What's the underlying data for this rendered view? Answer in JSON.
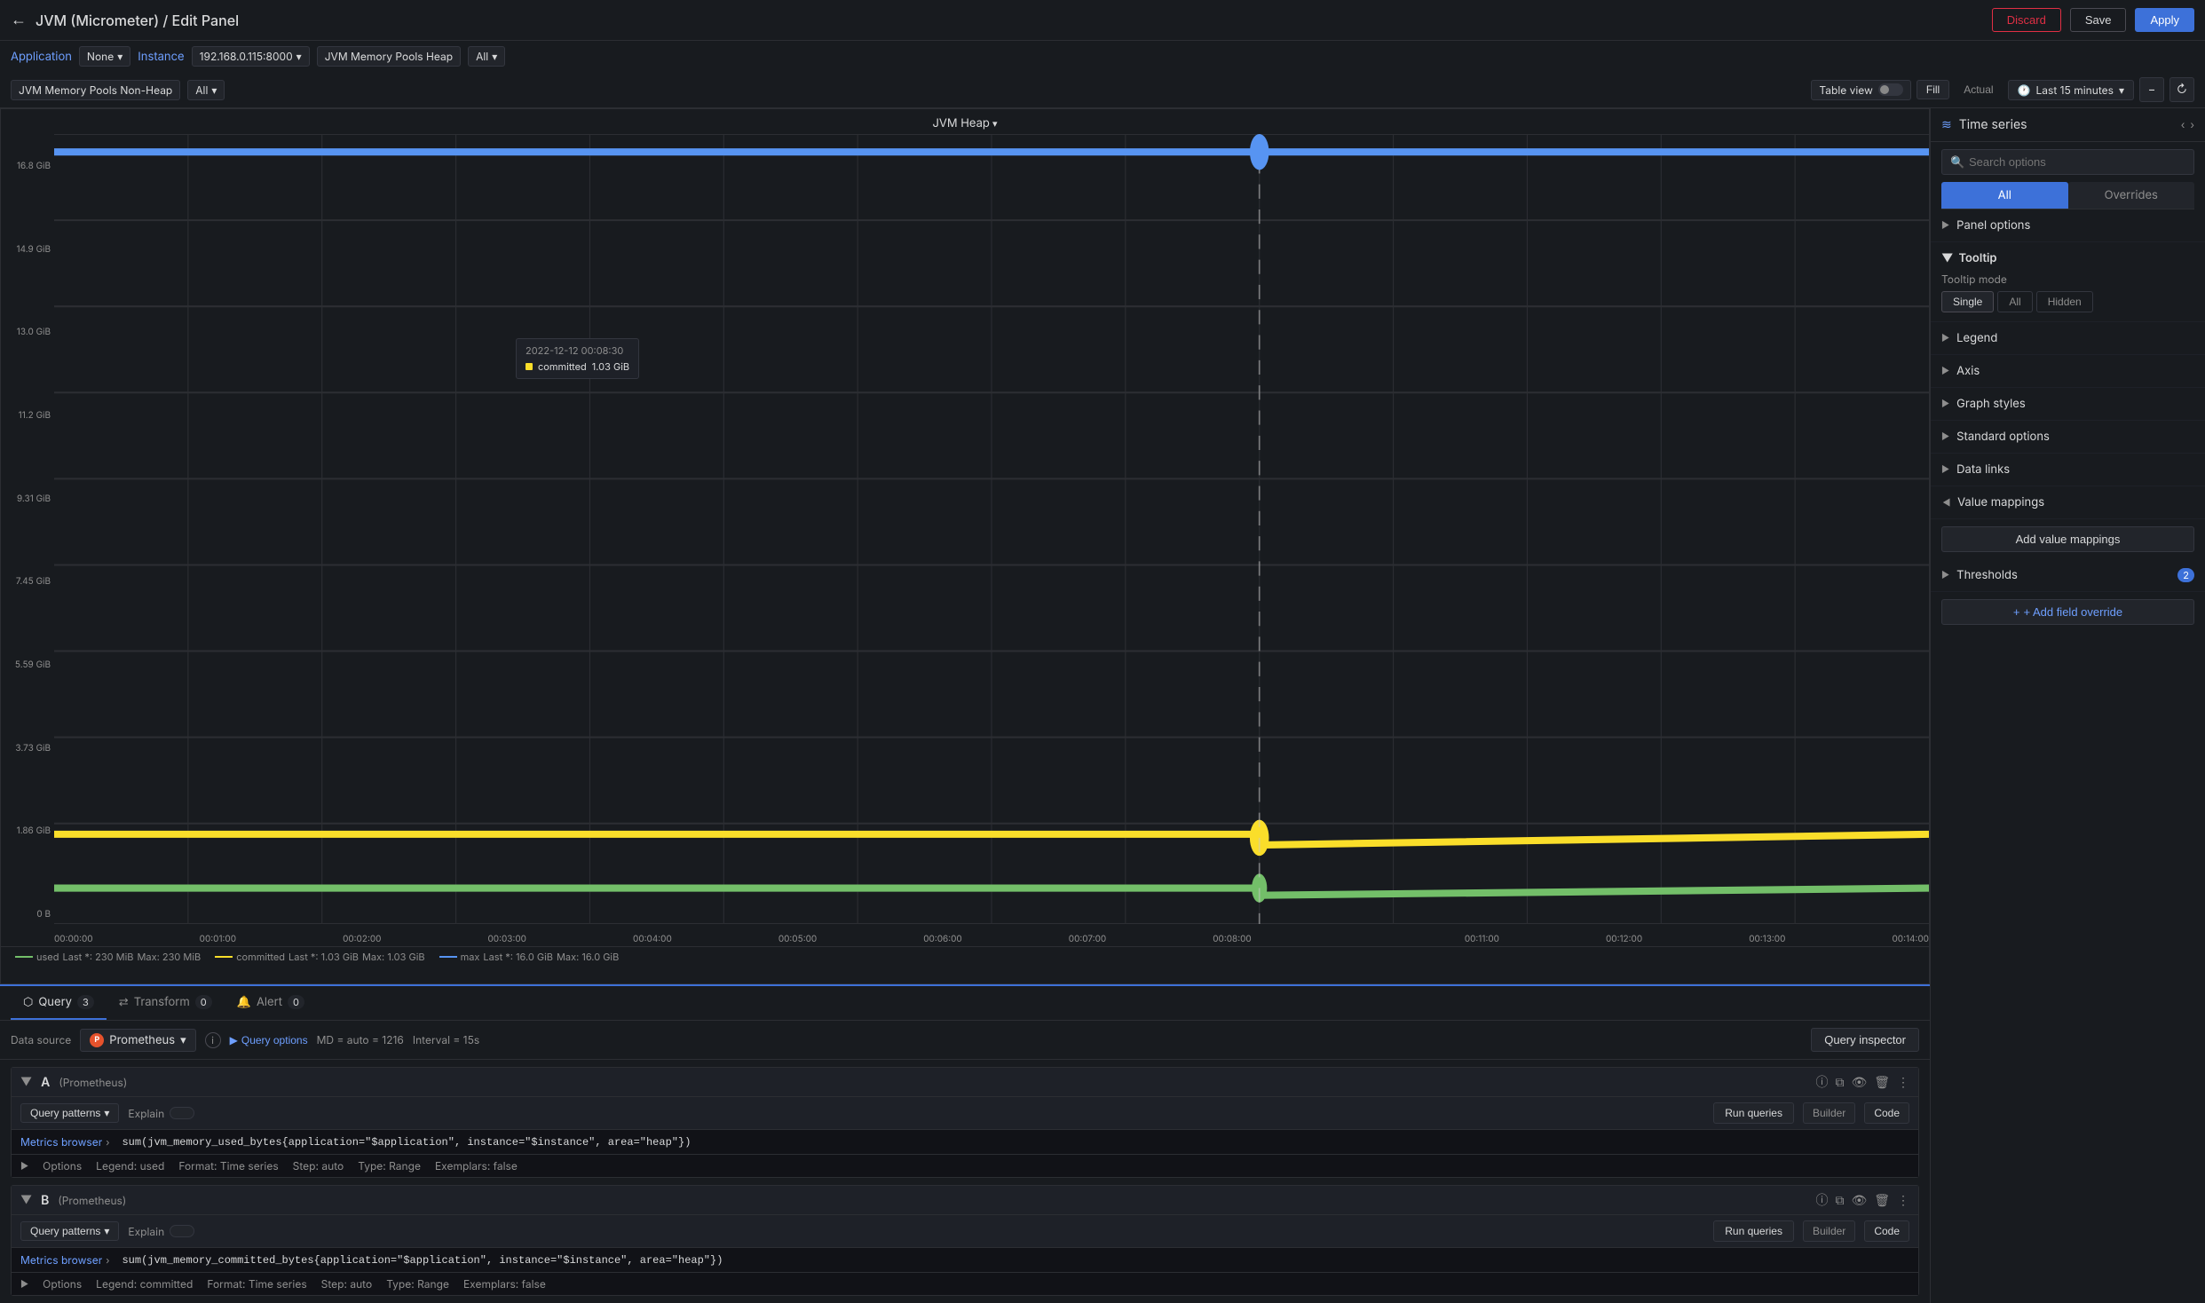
{
  "topbar": {
    "back_label": "←",
    "title": "JVM (Micrometer) / Edit Panel",
    "discard_label": "Discard",
    "save_label": "Save",
    "apply_label": "Apply"
  },
  "filterbar": {
    "application_label": "Application",
    "application_value": "None",
    "instance_label": "Instance",
    "instance_value": "192.168.0.115:8000",
    "heap_label": "JVM Memory Pools Heap",
    "heap_value": "All",
    "non_heap_label": "JVM Memory Pools Non-Heap",
    "non_heap_value": "All",
    "table_view_label": "Table view",
    "fill_label": "Fill",
    "actual_label": "Actual",
    "time_label": "Last 15 minutes"
  },
  "chart": {
    "title": "JVM Heap",
    "y_labels": [
      "16.8 GiB",
      "14.9 GiB",
      "13.0 GiB",
      "11.2 GiB",
      "9.31 GiB",
      "7.45 GiB",
      "5.59 GiB",
      "3.73 GiB",
      "1.86 GiB",
      "0 B"
    ],
    "x_labels": [
      "00:00:00",
      "00:01:00",
      "00:02:00",
      "00:03:00",
      "00:04:00",
      "00:05:00",
      "00:06:00",
      "00:07:00",
      "00:08:00",
      "",
      "00:11:00",
      "00:12:00",
      "00:13:00",
      "00:14:00"
    ],
    "tooltip": {
      "time": "2022-12-12 00:08:30",
      "label": "committed",
      "value": "1.03 GiB"
    },
    "legend": [
      {
        "label": "used",
        "color": "#73bf69",
        "last": "Last *: 230 MiB",
        "max": "Max: 230 MiB"
      },
      {
        "label": "committed",
        "color": "#fade2a",
        "last": "Last *: 1.03 GiB",
        "max": "Max: 1.03 GiB"
      },
      {
        "label": "max",
        "color": "#5794f2",
        "last": "Last *: 16.0 GiB",
        "max": "Max: 16.0 GiB"
      }
    ]
  },
  "query_tabs": {
    "query_label": "Query",
    "query_count": "3",
    "transform_label": "Transform",
    "transform_count": "0",
    "alert_label": "Alert",
    "alert_count": "0"
  },
  "datasource_bar": {
    "label": "Data source",
    "name": "Prometheus",
    "query_options_label": "Query options",
    "md_label": "MD = auto = 1216",
    "interval_label": "Interval = 15s",
    "inspector_label": "Query inspector"
  },
  "queries": [
    {
      "id": "A",
      "source": "(Prometheus)",
      "patterns_label": "Query patterns",
      "explain_label": "Explain",
      "run_label": "Run queries",
      "builder_label": "Builder",
      "code_label": "Code",
      "metrics_label": "Metrics browser",
      "expr": "sum(jvm_memory_used_bytes{application=\"$application\", instance=\"$instance\", area=\"heap\"})",
      "options_label": "Options",
      "legend_val": "Legend: used",
      "format_val": "Format: Time series",
      "step_val": "Step: auto",
      "type_val": "Type: Range",
      "exemplars_val": "Exemplars: false"
    },
    {
      "id": "B",
      "source": "(Prometheus)",
      "patterns_label": "Query patterns",
      "explain_label": "Explain",
      "run_label": "Run queries",
      "builder_label": "Builder",
      "code_label": "Code",
      "metrics_label": "Metrics browser",
      "expr": "sum(jvm_memory_committed_bytes{application=\"$application\", instance=\"$instance\", area=\"heap\"})",
      "options_label": "Options",
      "legend_val": "Legend: committed",
      "format_val": "Format: Time series",
      "step_val": "Step: auto",
      "type_val": "Type: Range",
      "exemplars_val": "Exemplars: false"
    }
  ],
  "sidebar": {
    "title": "Time series",
    "search_placeholder": "Search options",
    "tab_all": "All",
    "tab_overrides": "Overrides",
    "sections": [
      {
        "label": "Panel options",
        "expanded": false
      },
      {
        "label": "Tooltip",
        "expanded": true
      },
      {
        "label": "Legend",
        "expanded": false
      },
      {
        "label": "Axis",
        "expanded": false
      },
      {
        "label": "Graph styles",
        "expanded": false
      },
      {
        "label": "Standard options",
        "expanded": false
      },
      {
        "label": "Data links",
        "expanded": false
      },
      {
        "label": "Value mappings",
        "expanded": true
      },
      {
        "label": "Thresholds",
        "expanded": false,
        "badge": "2"
      }
    ],
    "tooltip_mode_label": "Tooltip mode",
    "tooltip_modes": [
      "Single",
      "All",
      "Hidden"
    ],
    "tooltip_mode_active": "Single",
    "add_mapping_label": "Add value mappings",
    "add_override_label": "+ Add field override"
  }
}
